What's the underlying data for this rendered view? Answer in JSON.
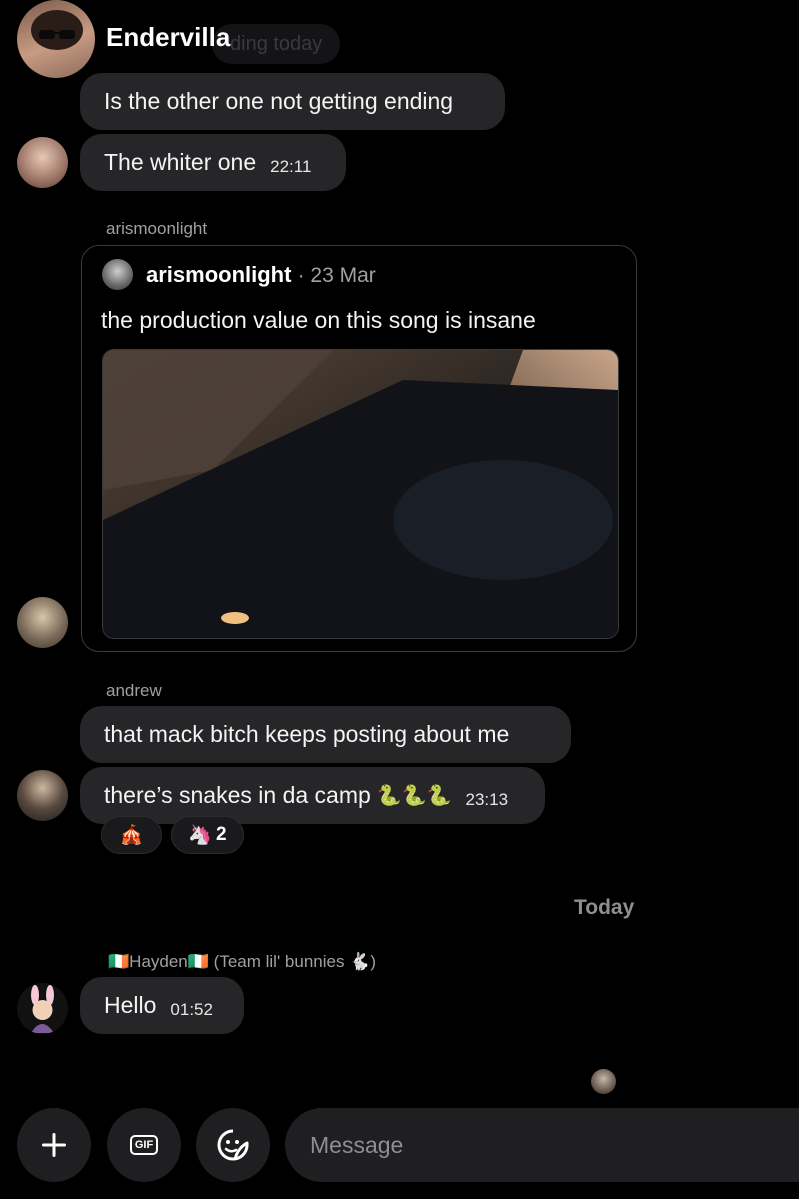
{
  "header": {
    "name": "Endervilla",
    "faded_text": "ding today"
  },
  "messages": {
    "m1": {
      "text": "Is the other one not getting ending"
    },
    "m2": {
      "text": "The whiter one",
      "time": "22:11"
    },
    "share": {
      "sender": "arismoonlight",
      "author": "arismoonlight",
      "date": "· 23 Mar",
      "caption": "the production value on this song is insane"
    },
    "andrew": {
      "sender": "andrew",
      "m1": "that mack bitch keeps posting about me",
      "m2": "there’s snakes in da camp",
      "m2_emoji": "🐍🐍🐍",
      "m2_time": "23:13",
      "reactions": [
        {
          "emoji": "🎪",
          "count": ""
        },
        {
          "emoji": "🦄",
          "count": "2"
        }
      ]
    },
    "divider": "Today",
    "hayden": {
      "sender": "🇮🇪Hayden🇮🇪 (Team lil' bunnies 🐇)",
      "text": "Hello",
      "time": "01:52"
    }
  },
  "composer": {
    "placeholder": "Message",
    "add_icon": "plus-icon",
    "gif_label": "GIF",
    "sticker_icon": "sticker-icon"
  },
  "colors": {
    "background": "#000000",
    "bubble": "#262628",
    "secondary_text": "#a0a0a5"
  }
}
